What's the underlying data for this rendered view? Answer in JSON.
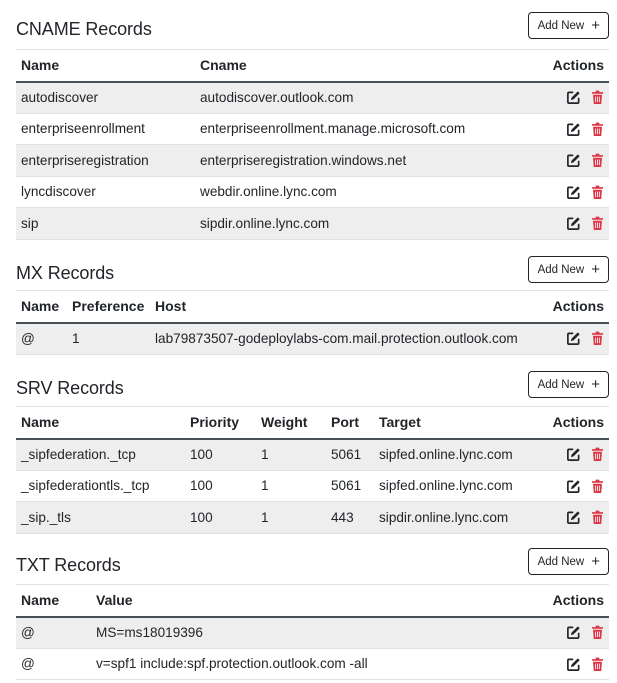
{
  "add_new_label": "Add New",
  "actions_header": "Actions",
  "colors": {
    "edit": "#212529",
    "delete": "#dc3545",
    "stripe": "#eeeeee"
  },
  "icons": {
    "edit": "edit-icon",
    "delete": "trash-icon",
    "add": "plus-icon"
  },
  "cname": {
    "title": "CNAME Records",
    "columns": [
      "Name",
      "Cname"
    ],
    "rows": [
      [
        "autodiscover",
        "autodiscover.outlook.com"
      ],
      [
        "enterpriseenrollment",
        "enterpriseenrollment.manage.microsoft.com"
      ],
      [
        "enterpriseregistration",
        "enterpriseregistration.windows.net"
      ],
      [
        "lyncdiscover",
        "webdir.online.lync.com"
      ],
      [
        "sip",
        "sipdir.online.lync.com"
      ]
    ]
  },
  "mx": {
    "title": "MX Records",
    "columns": [
      "Name",
      "Preference",
      "Host"
    ],
    "rows": [
      [
        "@",
        "1",
        "lab79873507-godeploylabs-com.mail.protection.outlook.com"
      ]
    ]
  },
  "srv": {
    "title": "SRV Records",
    "columns": [
      "Name",
      "Priority",
      "Weight",
      "Port",
      "Target"
    ],
    "rows": [
      [
        "_sipfederation._tcp",
        "100",
        "1",
        "5061",
        "sipfed.online.lync.com"
      ],
      [
        "_sipfederationtls._tcp",
        "100",
        "1",
        "5061",
        "sipfed.online.lync.com"
      ],
      [
        "_sip._tls",
        "100",
        "1",
        "443",
        "sipdir.online.lync.com"
      ]
    ]
  },
  "txt": {
    "title": "TXT Records",
    "columns": [
      "Name",
      "Value"
    ],
    "rows": [
      [
        "@",
        "MS=ms18019396"
      ],
      [
        "@",
        "v=spf1 include:spf.protection.outlook.com -all"
      ]
    ]
  }
}
